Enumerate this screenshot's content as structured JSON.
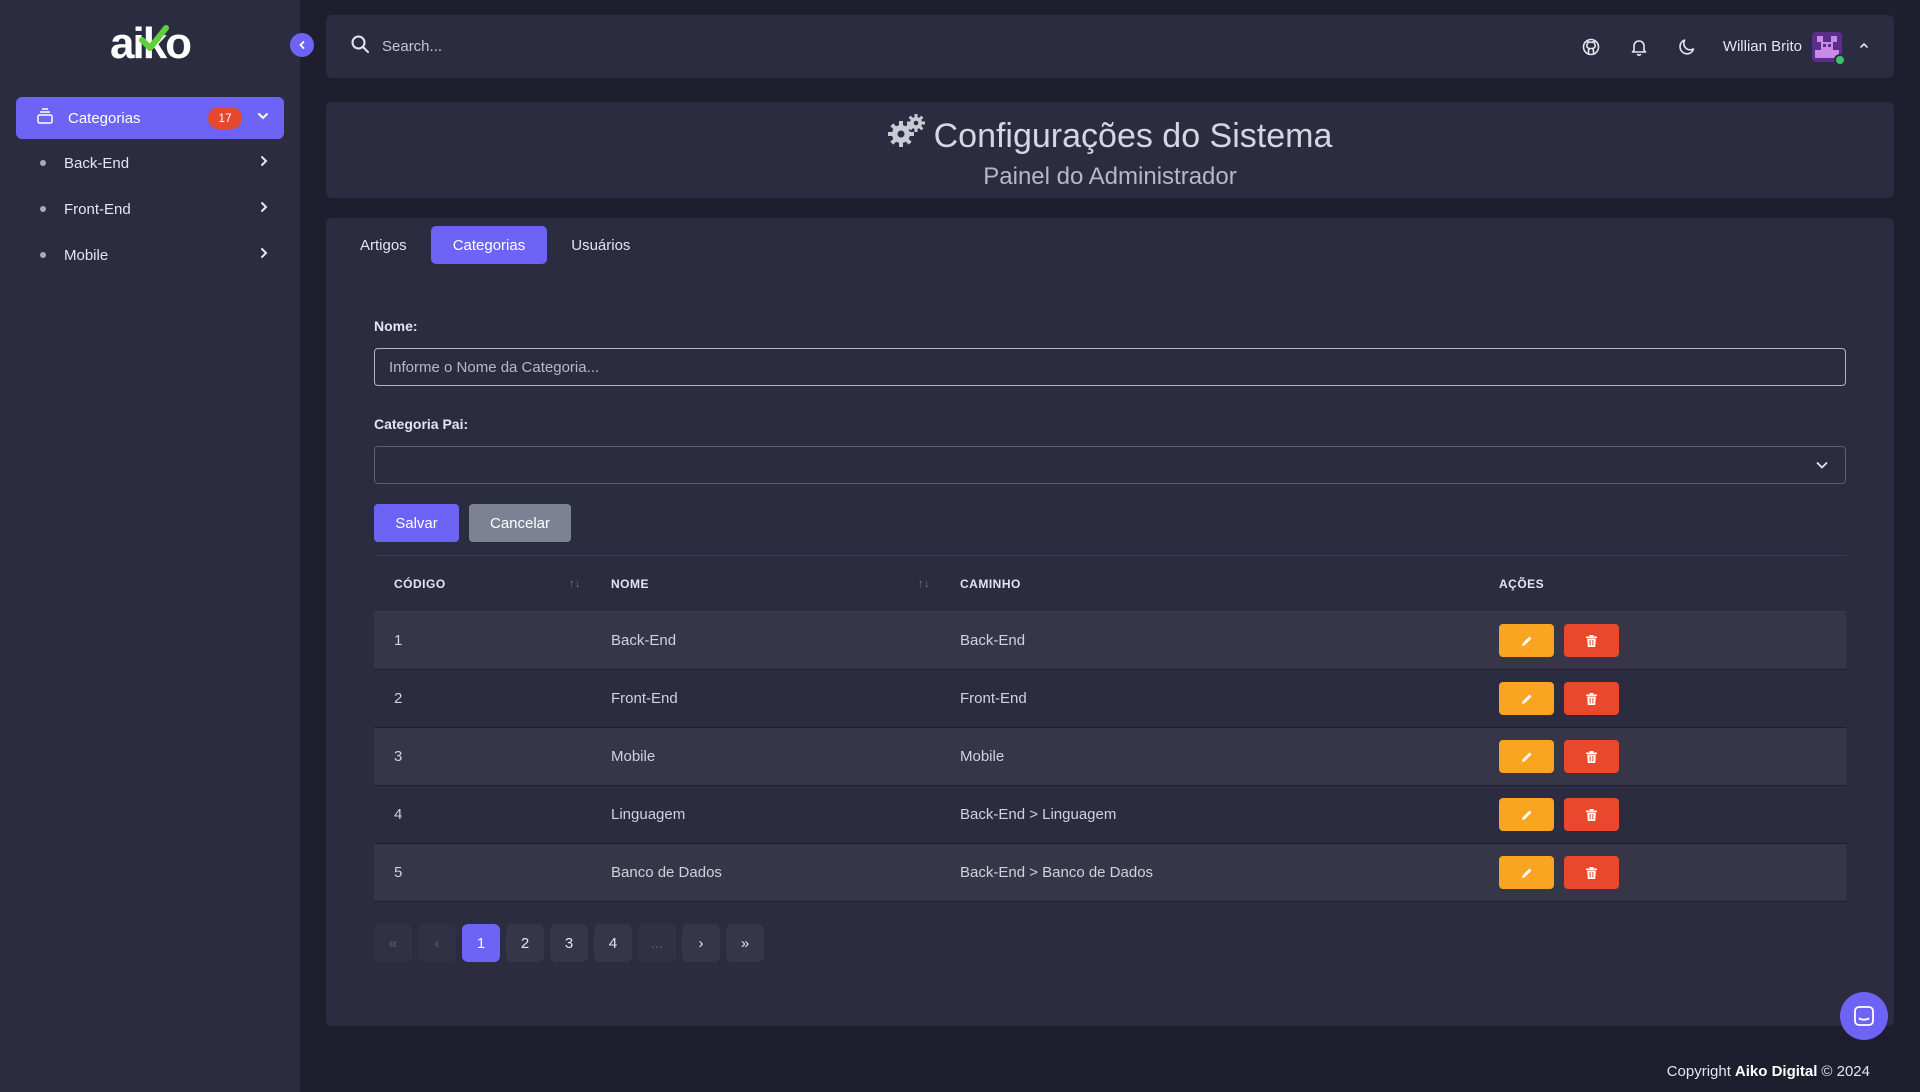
{
  "sidebar": {
    "logo_text": "aiko",
    "active_item": {
      "label": "Categorias",
      "badge": "17",
      "icon": "stack-icon"
    },
    "items": [
      {
        "label": "Back-End"
      },
      {
        "label": "Front-End"
      },
      {
        "label": "Mobile"
      }
    ]
  },
  "topbar": {
    "search_placeholder": "Search...",
    "user_name": "Willian Brito",
    "icons": [
      "github-icon",
      "bell-icon",
      "moon-icon"
    ]
  },
  "header": {
    "title": "Configurações do Sistema",
    "subtitle": "Painel do Administrador"
  },
  "tabs": [
    {
      "label": "Artigos"
    },
    {
      "label": "Categorias",
      "active": true
    },
    {
      "label": "Usuários"
    }
  ],
  "form": {
    "name_label": "Nome:",
    "name_placeholder": "Informe o Nome da Categoria...",
    "name_value": "",
    "parent_label": "Categoria Pai:",
    "parent_value": "",
    "save_label": "Salvar",
    "cancel_label": "Cancelar"
  },
  "table": {
    "columns": [
      "CÓDIGO",
      "NOME",
      "CAMINHO",
      "AÇÕES"
    ],
    "sort_glyph": "↑↓",
    "rows": [
      {
        "code": "1",
        "name": "Back-End",
        "path": "Back-End"
      },
      {
        "code": "2",
        "name": "Front-End",
        "path": "Front-End"
      },
      {
        "code": "3",
        "name": "Mobile",
        "path": "Mobile"
      },
      {
        "code": "4",
        "name": "Linguagem",
        "path": "Back-End > Linguagem"
      },
      {
        "code": "5",
        "name": "Banco de Dados",
        "path": "Back-End > Banco de Dados"
      }
    ]
  },
  "pagination": {
    "first": "«",
    "prev": "‹",
    "pages": [
      "1",
      "2",
      "3",
      "4"
    ],
    "ellipsis": "...",
    "next": "›",
    "last": "»",
    "current": "1"
  },
  "footer": {
    "prefix": "Copyright",
    "company": "Aiko Digital",
    "suffix": "© 2024"
  },
  "colors": {
    "accent": "#6d63f5",
    "edit": "#f9a521",
    "delete": "#e9482d",
    "badge": "#e5472f",
    "online": "#3cc16b"
  }
}
